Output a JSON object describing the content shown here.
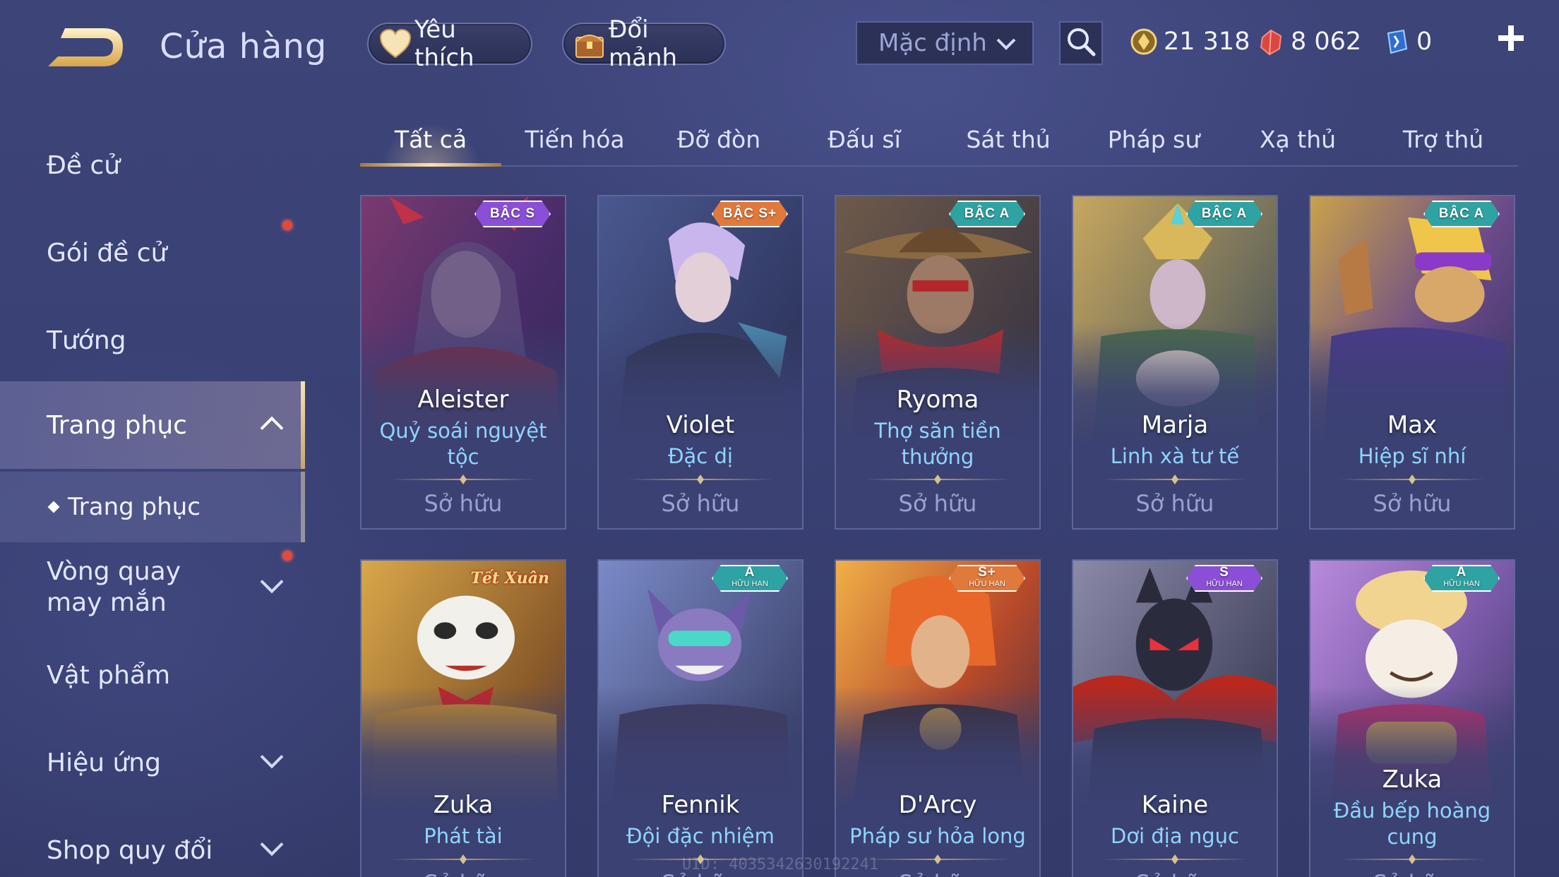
{
  "header": {
    "title": "Cửa hàng",
    "favorite_label": "Yêu thích",
    "exchange_label": "Đổi mảnh",
    "sort_value": "Mặc định",
    "currencies": [
      {
        "name": "gold",
        "value": "21 318",
        "color": "#e2c25a"
      },
      {
        "name": "voucher",
        "value": "8 062",
        "color": "#e2524a"
      },
      {
        "name": "crystal",
        "value": "0",
        "color": "#6db7ff"
      }
    ]
  },
  "sidebar": {
    "items": [
      {
        "label": "Đề cử"
      },
      {
        "label": "Gói đề cử",
        "notify": true
      },
      {
        "label": "Tướng"
      },
      {
        "label": "Trang phục",
        "expanded": true
      },
      {
        "label": "Trang phục"
      },
      {
        "label": "Vòng quay may mắn",
        "notify": true
      },
      {
        "label": "Vật phẩm"
      },
      {
        "label": "Hiệu ứng"
      },
      {
        "label": "Shop quy đổi"
      }
    ]
  },
  "tabs": [
    {
      "label": "Tất cả",
      "active": true
    },
    {
      "label": "Tiến hóa"
    },
    {
      "label": "Đỡ đòn"
    },
    {
      "label": "Đấu sĩ"
    },
    {
      "label": "Sát thủ"
    },
    {
      "label": "Pháp sư"
    },
    {
      "label": "Xạ thủ"
    },
    {
      "label": "Trợ thủ"
    }
  ],
  "cards": [
    {
      "hero": "Aleister",
      "skin": "Quỷ soái nguyệt tộc",
      "status": "Sở hữu",
      "badge": "BẬC S",
      "badge_color": "#8a4fd6"
    },
    {
      "hero": "Violet",
      "skin": "Đặc dị",
      "status": "Sở hữu",
      "badge": "BẬC S+",
      "badge_color": "#e07a3c"
    },
    {
      "hero": "Ryoma",
      "skin": "Thợ săn tiền thưởng",
      "status": "Sở hữu",
      "badge": "BẬC A",
      "badge_color": "#2fa3a3"
    },
    {
      "hero": "Marja",
      "skin": "Linh xà tư tế",
      "status": "Sở hữu",
      "badge": "BẬC A",
      "badge_color": "#2fa3a3"
    },
    {
      "hero": "Max",
      "skin": "Hiệp sĩ nhí",
      "status": "Sở hữu",
      "badge": "BẬC A",
      "badge_color": "#2fa3a3"
    },
    {
      "hero": "Zuka",
      "skin": "Phát tài",
      "status": "Sở hữu",
      "event_tag": "Tết Xuân"
    },
    {
      "hero": "Fennik",
      "skin": "Đội đặc nhiệm",
      "status": "Sở hữu",
      "badge": "A",
      "badge_sub": "HỮU HẠN",
      "badge_color": "#2fa3a3"
    },
    {
      "hero": "D'Arcy",
      "skin": "Pháp sư hỏa long",
      "status": "Sở hữu",
      "badge": "S+",
      "badge_sub": "HỮU HẠN",
      "badge_color": "#e07a3c"
    },
    {
      "hero": "Kaine",
      "skin": "Dơi địa ngục",
      "status": "Sở hữu",
      "badge": "S",
      "badge_sub": "HỮU HẠN",
      "badge_color": "#8a4fd6"
    },
    {
      "hero": "Zuka",
      "skin": "Đầu bếp hoàng cung",
      "status": "Sở hữu",
      "badge": "A",
      "badge_sub": "HỮU HẠN",
      "badge_color": "#2fa3a3"
    }
  ],
  "uid_text": "UID: 4035342630192241"
}
